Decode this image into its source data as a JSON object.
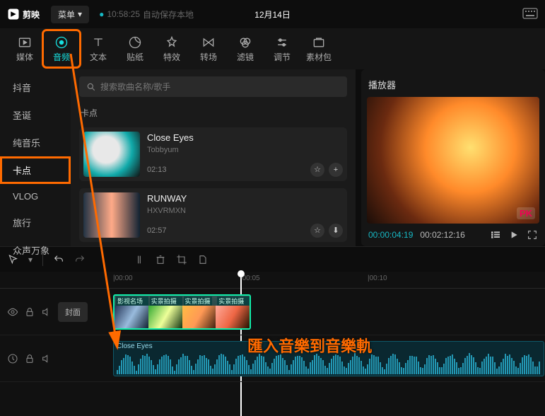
{
  "titlebar": {
    "app_name": "剪映",
    "menu_label": "菜单",
    "save_time": "10:58:25",
    "save_text": "自动保存本地",
    "date": "12月14日"
  },
  "top_tabs": [
    {
      "id": "media",
      "label": "媒体"
    },
    {
      "id": "audio",
      "label": "音频"
    },
    {
      "id": "text",
      "label": "文本"
    },
    {
      "id": "sticker",
      "label": "贴纸"
    },
    {
      "id": "effect",
      "label": "特效"
    },
    {
      "id": "transition",
      "label": "转场"
    },
    {
      "id": "filter",
      "label": "滤镜"
    },
    {
      "id": "adjust",
      "label": "调节"
    },
    {
      "id": "material",
      "label": "素材包"
    }
  ],
  "side_items": [
    {
      "id": "douyin",
      "label": "抖音"
    },
    {
      "id": "shengdan",
      "label": "圣诞"
    },
    {
      "id": "pure",
      "label": "纯音乐"
    },
    {
      "id": "kadian",
      "label": "卡点"
    },
    {
      "id": "vlog",
      "label": "VLOG"
    },
    {
      "id": "travel",
      "label": "旅行"
    },
    {
      "id": "zswx",
      "label": "众声万象"
    }
  ],
  "search": {
    "placeholder": "搜索歌曲名称/歌手"
  },
  "section_title": "卡点",
  "tracks": [
    {
      "title": "Close Eyes",
      "artist": "Tobbyum",
      "duration": "02:13",
      "act2": "plus"
    },
    {
      "title": "RUNWAY",
      "artist": "HXVRMXN",
      "duration": "02:57",
      "act2": "download"
    }
  ],
  "player": {
    "title": "播放器",
    "watermark": "PK",
    "time_current": "00:00:04:19",
    "time_total": "00:02:12:16"
  },
  "ruler": {
    "t0": "|00:00",
    "t1": "|00:05",
    "t2": "|00:10"
  },
  "timeline": {
    "cover_label": "封面",
    "video_segs": [
      "影视名场面",
      "实景拍摄 荷",
      "实景拍摄",
      "实景拍摄 浏"
    ],
    "audio_clip_label": "Close Eyes"
  },
  "annotation": "匯入音樂到音樂軌",
  "icons": {
    "star": "star-icon",
    "plus": "plus-icon",
    "download": "download-icon",
    "search": "search-icon",
    "keyboard": "keyboard-icon",
    "check": "check-icon",
    "play": "play-icon",
    "list": "list-icon",
    "fullscreen": "fullscreen-icon",
    "undo": "undo-icon",
    "redo": "redo-icon",
    "cursor": "cursor-icon",
    "split": "split-icon",
    "delete": "delete-icon",
    "crop": "crop-icon",
    "marker": "marker-icon",
    "eye": "eye-icon",
    "lock": "lock-icon",
    "mute": "mute-icon",
    "time": "time-icon"
  }
}
